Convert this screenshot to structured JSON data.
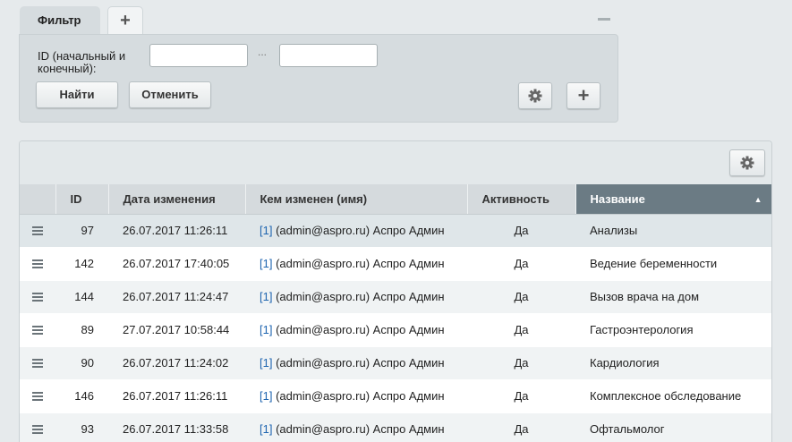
{
  "filter": {
    "tab_label": "Фильтр",
    "add_tab_label": "+",
    "id_label": "ID (начальный и конечный):",
    "id_from_value": "",
    "id_to_value": "",
    "range_separator": "...",
    "find_label": "Найти",
    "cancel_label": "Отменить",
    "add_label": "+"
  },
  "grid": {
    "columns": [
      "ID",
      "Дата изменения",
      "Кем изменен (имя)",
      "Активность",
      "Название"
    ],
    "sort_indicator": "▲",
    "rows": [
      {
        "id": "97",
        "date": "26.07.2017 11:26:11",
        "user_id": "[1]",
        "user": " (admin@aspro.ru) Аспро Админ",
        "active": "Да",
        "name": "Анализы"
      },
      {
        "id": "142",
        "date": "26.07.2017 17:40:05",
        "user_id": "[1]",
        "user": " (admin@aspro.ru) Аспро Админ",
        "active": "Да",
        "name": "Ведение беременности"
      },
      {
        "id": "144",
        "date": "26.07.2017 11:24:47",
        "user_id": "[1]",
        "user": " (admin@aspro.ru) Аспро Админ",
        "active": "Да",
        "name": "Вызов врача на дом"
      },
      {
        "id": "89",
        "date": "27.07.2017 10:58:44",
        "user_id": "[1]",
        "user": " (admin@aspro.ru) Аспро Админ",
        "active": "Да",
        "name": "Гастроэнтерология"
      },
      {
        "id": "90",
        "date": "26.07.2017 11:24:02",
        "user_id": "[1]",
        "user": " (admin@aspro.ru) Аспро Админ",
        "active": "Да",
        "name": "Кардиология"
      },
      {
        "id": "146",
        "date": "26.07.2017 11:26:11",
        "user_id": "[1]",
        "user": " (admin@aspro.ru) Аспро Админ",
        "active": "Да",
        "name": "Комплексное обследование"
      },
      {
        "id": "93",
        "date": "26.07.2017 11:33:58",
        "user_id": "[1]",
        "user": " (admin@aspro.ru) Аспро Админ",
        "active": "Да",
        "name": "Офтальмолог"
      }
    ]
  },
  "icons": {
    "settings": "gear-icon",
    "row_menu": "hamburger-icon",
    "collapse": "minus-icon"
  }
}
